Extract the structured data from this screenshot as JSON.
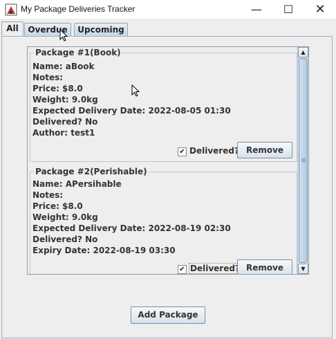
{
  "window": {
    "title": "My Package Deliveries Tracker",
    "min_glyph": "—",
    "max_glyph": "☐",
    "close_glyph": "✕"
  },
  "tabs": [
    {
      "label": "All"
    },
    {
      "label": "Overdue"
    },
    {
      "label": "Upcoming"
    }
  ],
  "packages": [
    {
      "title": "Package #1(Book)",
      "lines": [
        "Name: aBook",
        "Notes:",
        "Price: $8.0",
        "Weight: 9.0kg",
        "Expected Delivery Date: 2022-08-05 01:30",
        "Delivered? No",
        "Author: test1"
      ],
      "delivered_label": "Delivered?",
      "delivered_checked": true,
      "remove_label": "Remove"
    },
    {
      "title": "Package #2(Perishable)",
      "lines": [
        "Name: APersihable",
        "Notes:",
        "Price: $8.0",
        "Weight: 9.0kg",
        "Expected Delivery Date: 2022-08-19 02:30",
        "Delivered? No",
        "Expiry Date: 2022-08-19 03:30"
      ],
      "delivered_label": "Delivered?",
      "delivered_checked": true,
      "remove_label": "Remove"
    }
  ],
  "check_glyph": "✔",
  "scroll": {
    "up_glyph": "▲",
    "down_glyph": "▼"
  },
  "add_package_label": "Add Package"
}
